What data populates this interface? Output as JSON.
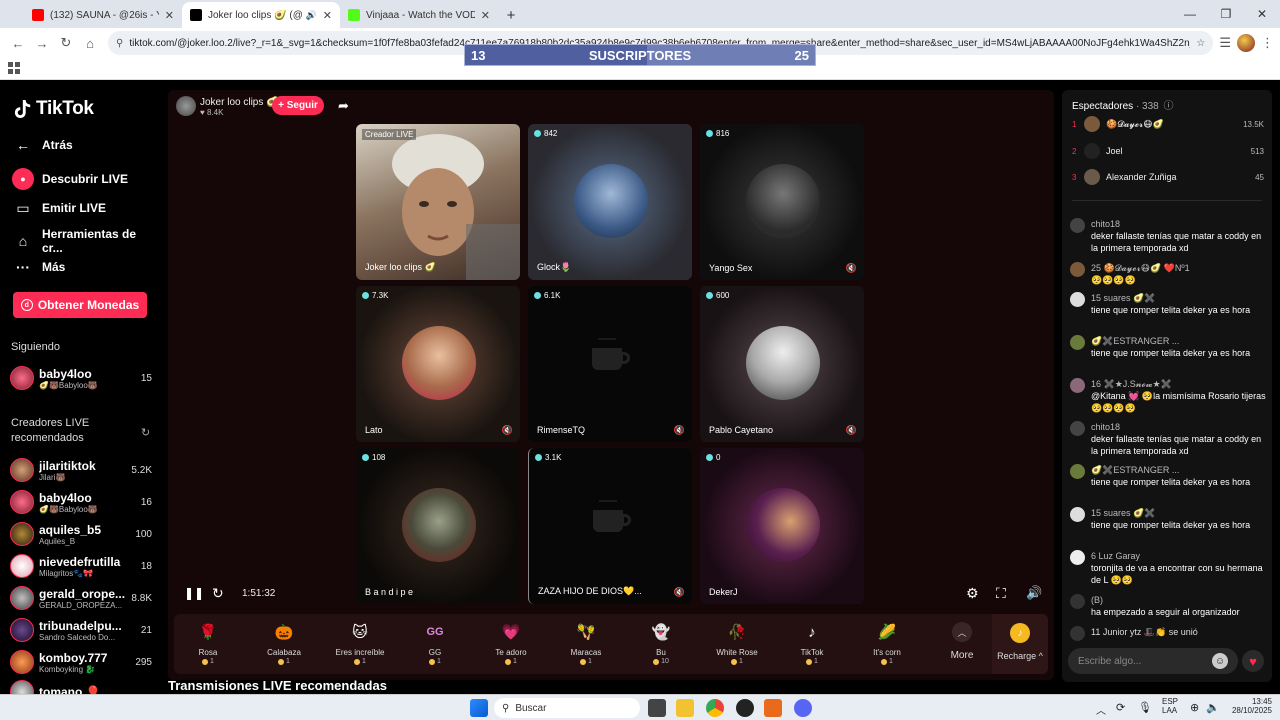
{
  "browser": {
    "tabs": [
      {
        "title": "(132) SAUNA - @26is - YouTube",
        "color": "#ff0000",
        "active": false
      },
      {
        "title": "Joker loo clips 🥑 (@joker.l",
        "color": "#000000",
        "active": true
      },
      {
        "title": "Vinjaaa - Watch the VOD on Kick",
        "color": "#53fc18",
        "active": false
      }
    ],
    "url": "tiktok.com/@joker.loo.2/live?_r=1&_svg=1&checksum=1f0f7fe8ba03fefad24c711ee7a76918b80b2dc35a924b8e9c7d99c38b6eb6708enter_from_merge=share&enter_method=share&sec_user_id=MS4wLjABAAAA00NoJFg4ehk1Wa4ShZ2n_Acuqv_tVxR..."
  },
  "overlay": {
    "subs_left": "13",
    "subs_label": "SUSCRIPTORES",
    "subs_right": "25",
    "subs_fraction": 0.52
  },
  "sidebar": {
    "logo": "TikTok",
    "nav": [
      {
        "label": "Atrás",
        "icon": "back-arrow-icon"
      },
      {
        "label": "Descubrir LIVE",
        "icon": "live-discover-icon"
      },
      {
        "label": "Emitir LIVE",
        "icon": "camera-icon"
      },
      {
        "label": "Herramientas de cr...",
        "icon": "home-tools-icon"
      },
      {
        "label": "Más",
        "icon": "more-dots-icon"
      }
    ],
    "coins_button": "Obtener Monedas",
    "following_title": "Siguiendo",
    "following": [
      {
        "name": "baby4loo",
        "sub": "🥑🐻Babyloo🐻",
        "count": "15"
      }
    ],
    "recommended_title": "Creadores LIVE recomendados",
    "recommended": [
      {
        "name": "jilaritiktok",
        "sub": "Jilari🐻",
        "count": "5.2K"
      },
      {
        "name": "baby4loo",
        "sub": "🥑🐻Babyloo🐻",
        "count": "16"
      },
      {
        "name": "aquiles_b5",
        "sub": "Aquiles_B",
        "count": "100"
      },
      {
        "name": "nievedefrutilla",
        "sub": "Milagritos🐾🎀",
        "count": "18"
      },
      {
        "name": "gerald_orope...",
        "sub": "GERALD_OROPEZA...",
        "count": "8.8K"
      },
      {
        "name": "tribunadelpu...",
        "sub": "Sandro Salcedo Do...",
        "count": "21"
      },
      {
        "name": "komboy.777",
        "sub": "Komboyking 🐉",
        "count": "295"
      },
      {
        "name": "tomano 🎈",
        "sub": "",
        "count": ""
      }
    ]
  },
  "stage": {
    "host_name": "Joker loo clips 🥑",
    "host_likes": "♥ 8.4K",
    "follow_label": "+ Seguir",
    "tiles": [
      {
        "badge": "Creador LIVE",
        "label": "Joker loo clips 🥑",
        "type": "video"
      },
      {
        "badge": "842",
        "label": "Glock🌷",
        "type": "avatar",
        "color": "#3b5a86"
      },
      {
        "badge": "816",
        "label": "Yango Sex",
        "type": "avatar",
        "color": "#2b2b2b"
      },
      {
        "badge": "7.3K",
        "label": "Lato",
        "type": "avatar",
        "color": "#a86a4a"
      },
      {
        "badge": "6.1K",
        "label": "RimenseTQ",
        "type": "cup"
      },
      {
        "badge": "600",
        "label": "Pablo Cayetano",
        "type": "avatar",
        "color": "#a9a9a9"
      },
      {
        "badge": "108",
        "label": "B a n d i p e",
        "type": "avatar",
        "color": "#4a4a3a"
      },
      {
        "badge": "3.1K",
        "label": "ZAZA HIJO DE DIOS💛...",
        "type": "cup"
      },
      {
        "badge": "0",
        "label": "DekerJ",
        "type": "avatar",
        "color": "#5a2050"
      }
    ],
    "time": "1:51:32",
    "gifts": [
      {
        "name": "Rosa",
        "price": "1",
        "icon": "🌹"
      },
      {
        "name": "Calabaza",
        "price": "1",
        "icon": "🎃"
      },
      {
        "name": "Eres increíble",
        "price": "1",
        "icon": "🐱"
      },
      {
        "name": "GG",
        "price": "1",
        "icon": "GG"
      },
      {
        "name": "Te adoro",
        "price": "1",
        "icon": "💗"
      },
      {
        "name": "Maracas",
        "price": "1",
        "icon": "🪇"
      },
      {
        "name": "Bu",
        "price": "10",
        "icon": "👻"
      },
      {
        "name": "White Rose",
        "price": "1",
        "icon": "🥀"
      },
      {
        "name": "TikTok",
        "price": "1",
        "icon": "♪"
      },
      {
        "name": "It's corn",
        "price": "1",
        "icon": "🌽"
      }
    ],
    "more_label": "More",
    "recharge_label": "Recharge ^"
  },
  "recommended_live_title": "Transmisiones LIVE recomendadas",
  "chat": {
    "viewers_label": "Espectadores",
    "viewers_count": "· 338",
    "top": [
      {
        "rank": "1",
        "name": "🍪𝓓𝓪𝔂𝓮𝓻😷🥑",
        "count": "13.5K",
        "color": "#7a5a3a"
      },
      {
        "rank": "2",
        "name": "Joel",
        "count": "513",
        "color": "#222222"
      },
      {
        "rank": "3",
        "name": "Alexander Zuñiga",
        "count": "45",
        "color": "#6a5a4a"
      }
    ],
    "messages": [
      {
        "user": "chito18",
        "text": "deker fallaste tenías que matar a coddy en la primera temporada xd",
        "color": "#444444"
      },
      {
        "user": "25 🍪𝓓𝓪𝔂𝓮𝓻😷🥑 ❤️Nº1",
        "text": "🥺🥺🥺🥺",
        "color": "#7a5a3a"
      },
      {
        "user": "15 suares 🥑✖️",
        "text": "tiene que romper telita deker ya es hora",
        "color": "#dddddd"
      },
      {
        "user": "🥑✖️ESTRANGER ...",
        "text": "tiene que romper telita deker ya es hora",
        "color": "#6a7a3a"
      },
      {
        "user": "16 ✖️★J.S𝓷𝓸𝔀★✖️",
        "text": "@Kitana 💓 🥺la mismísima Rosario tijeras 🥺🥺🥺🥺",
        "color": "#8a6a7a"
      },
      {
        "user": "chito18",
        "text": "deker fallaste tenías que matar a coddy en la primera temporada xd",
        "color": "#444444"
      },
      {
        "user": "🥑✖️ESTRANGER ...",
        "text": "tiene que romper telita deker ya es hora",
        "color": "#6a7a3a"
      },
      {
        "user": "15 suares 🥑✖️",
        "text": "tiene que romper telita deker ya es hora",
        "color": "#dddddd"
      },
      {
        "user": "6 Luz Garay",
        "text": "toronjita de va a encontrar con su hermana de L 🥺🥺",
        "color": "#eeeeee"
      },
      {
        "user": "(B)",
        "text": "ha empezado a seguir al organizador",
        "color": "#333333"
      },
      {
        "user": "11 Junior ytz 🎩👏 se unió",
        "text": "",
        "color": "#333333"
      }
    ],
    "input_placeholder": "Escribe algo..."
  },
  "taskbar": {
    "search_label": "Buscar",
    "lang1": "ESP",
    "lang2": "LAA",
    "time": "13:45",
    "date": "28/10/2025"
  }
}
